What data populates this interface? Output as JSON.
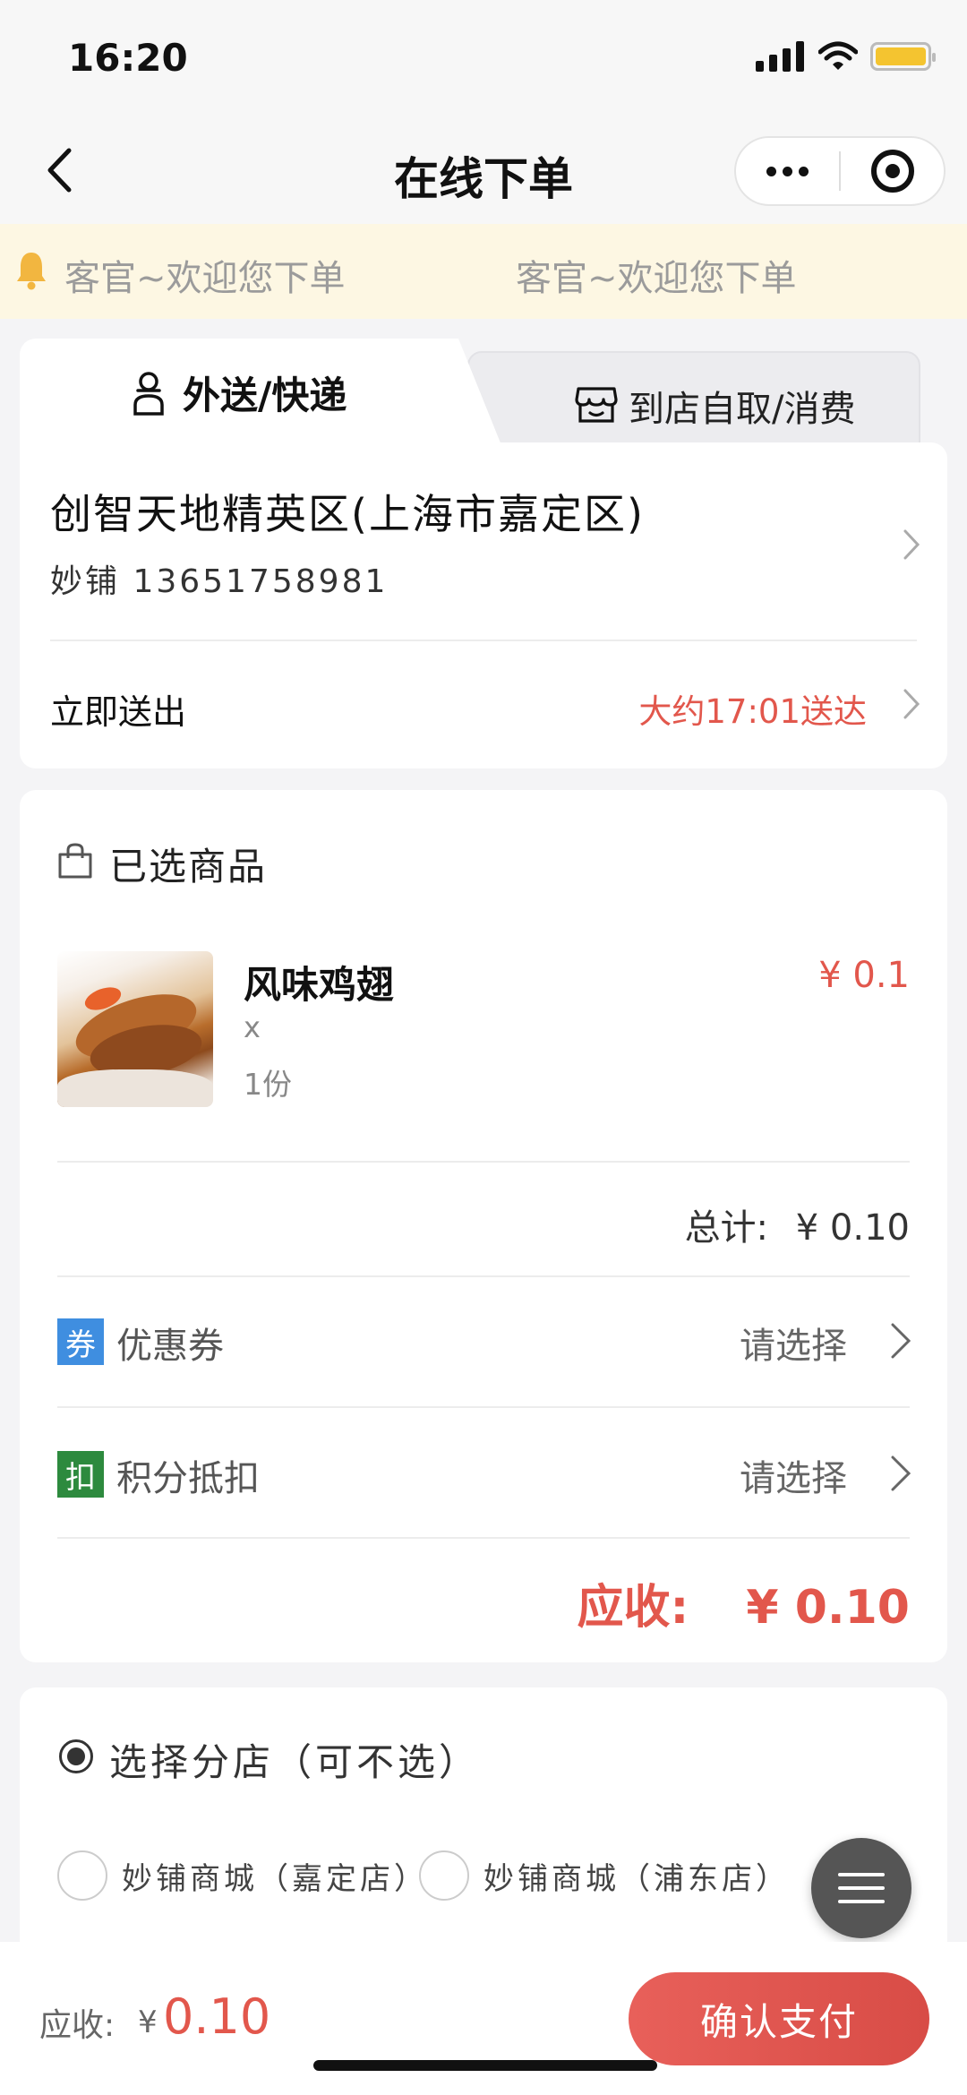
{
  "status_bar": {
    "time": "16:20"
  },
  "nav": {
    "title": "在线下单"
  },
  "notice": {
    "messages": [
      "客官~欢迎您下单",
      "客官~欢迎您下单"
    ]
  },
  "tabs": [
    {
      "label": "外送/快递",
      "active": true,
      "icon": "delivery-person-icon"
    },
    {
      "label": "到店自取/消费",
      "active": false,
      "icon": "store-icon"
    }
  ],
  "address": {
    "title": "创智天地精英区(上海市嘉定区)",
    "contact": "妙铺 13651758981",
    "delivery_label": "立即送出",
    "delivery_time": "大约17:01送达"
  },
  "order": {
    "section_title": "已选商品",
    "items": [
      {
        "name": "风味鸡翅",
        "spec": "x",
        "quantity": "1份",
        "price": "¥ 0.1"
      }
    ],
    "total_label": "总计:",
    "total_value": "¥ 0.10",
    "coupon": {
      "badge": "券",
      "label": "优惠券",
      "value": "请选择",
      "badge_color": "#3f8ee0"
    },
    "points": {
      "badge": "扣",
      "label": "积分抵扣",
      "value": "请选择",
      "badge_color": "#2d8a3e"
    },
    "due_label": "应收:",
    "due_value": "¥ 0.10"
  },
  "branch": {
    "title": "选择分店（可不选）",
    "options": [
      "妙铺商城（嘉定店）",
      "妙铺商城（浦东店）"
    ]
  },
  "bottom": {
    "due_label": "应收:",
    "currency": "¥",
    "amount": "0.10",
    "pay_label": "确认支付"
  },
  "colors": {
    "accent": "#e2574c",
    "notice_bg": "#fdf7e3",
    "page_bg": "#f4f4f6"
  }
}
